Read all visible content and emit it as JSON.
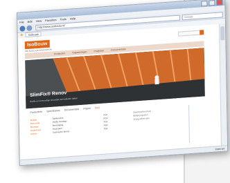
{
  "browser": {
    "menu": [
      "File",
      "Edit",
      "View",
      "Favorites",
      "Tools",
      "Help"
    ],
    "address": "http://www.isobouw.nl/",
    "search_placeholder": "Google",
    "tab_label": "Isobouw",
    "status": "Internet"
  },
  "site": {
    "logo": "IsoBouw",
    "tagline": "WE BUILD ON INNOVATION",
    "nav": [
      "Producten",
      "Toepassingen",
      "Projecten",
      "Documentatie"
    ],
    "hero_title": "SlimFix® Renov",
    "hero_sub": "Snelle en eenvoudige renovatie van hellende daken",
    "subtabs": [
      "Productinfo",
      "Specificaties",
      "Documentatie",
      "Prijzen",
      "FAQ"
    ],
    "rows": [
      {
        "c1": "Isolatie",
        "c2": "Dakbeschot",
        "c3": "PDF"
      },
      {
        "c1": "Renovatie",
        "c2": "Snelle montage",
        "c3": "PDF"
      },
      {
        "c1": "Montage",
        "c2": "Bevestiging",
        "c3": "PDF"
      },
      {
        "c1": "Onderhoud",
        "c2": "Duurzaam",
        "c3": "PDF"
      },
      {
        "c1": "Advies",
        "c2": "Technische dienst",
        "c3": "PDF"
      }
    ],
    "right_links": [
      "Download brochure",
      "Bekijk projecten",
      "Vraag advies aan"
    ]
  },
  "colors": {
    "brand": "#e2651a"
  }
}
